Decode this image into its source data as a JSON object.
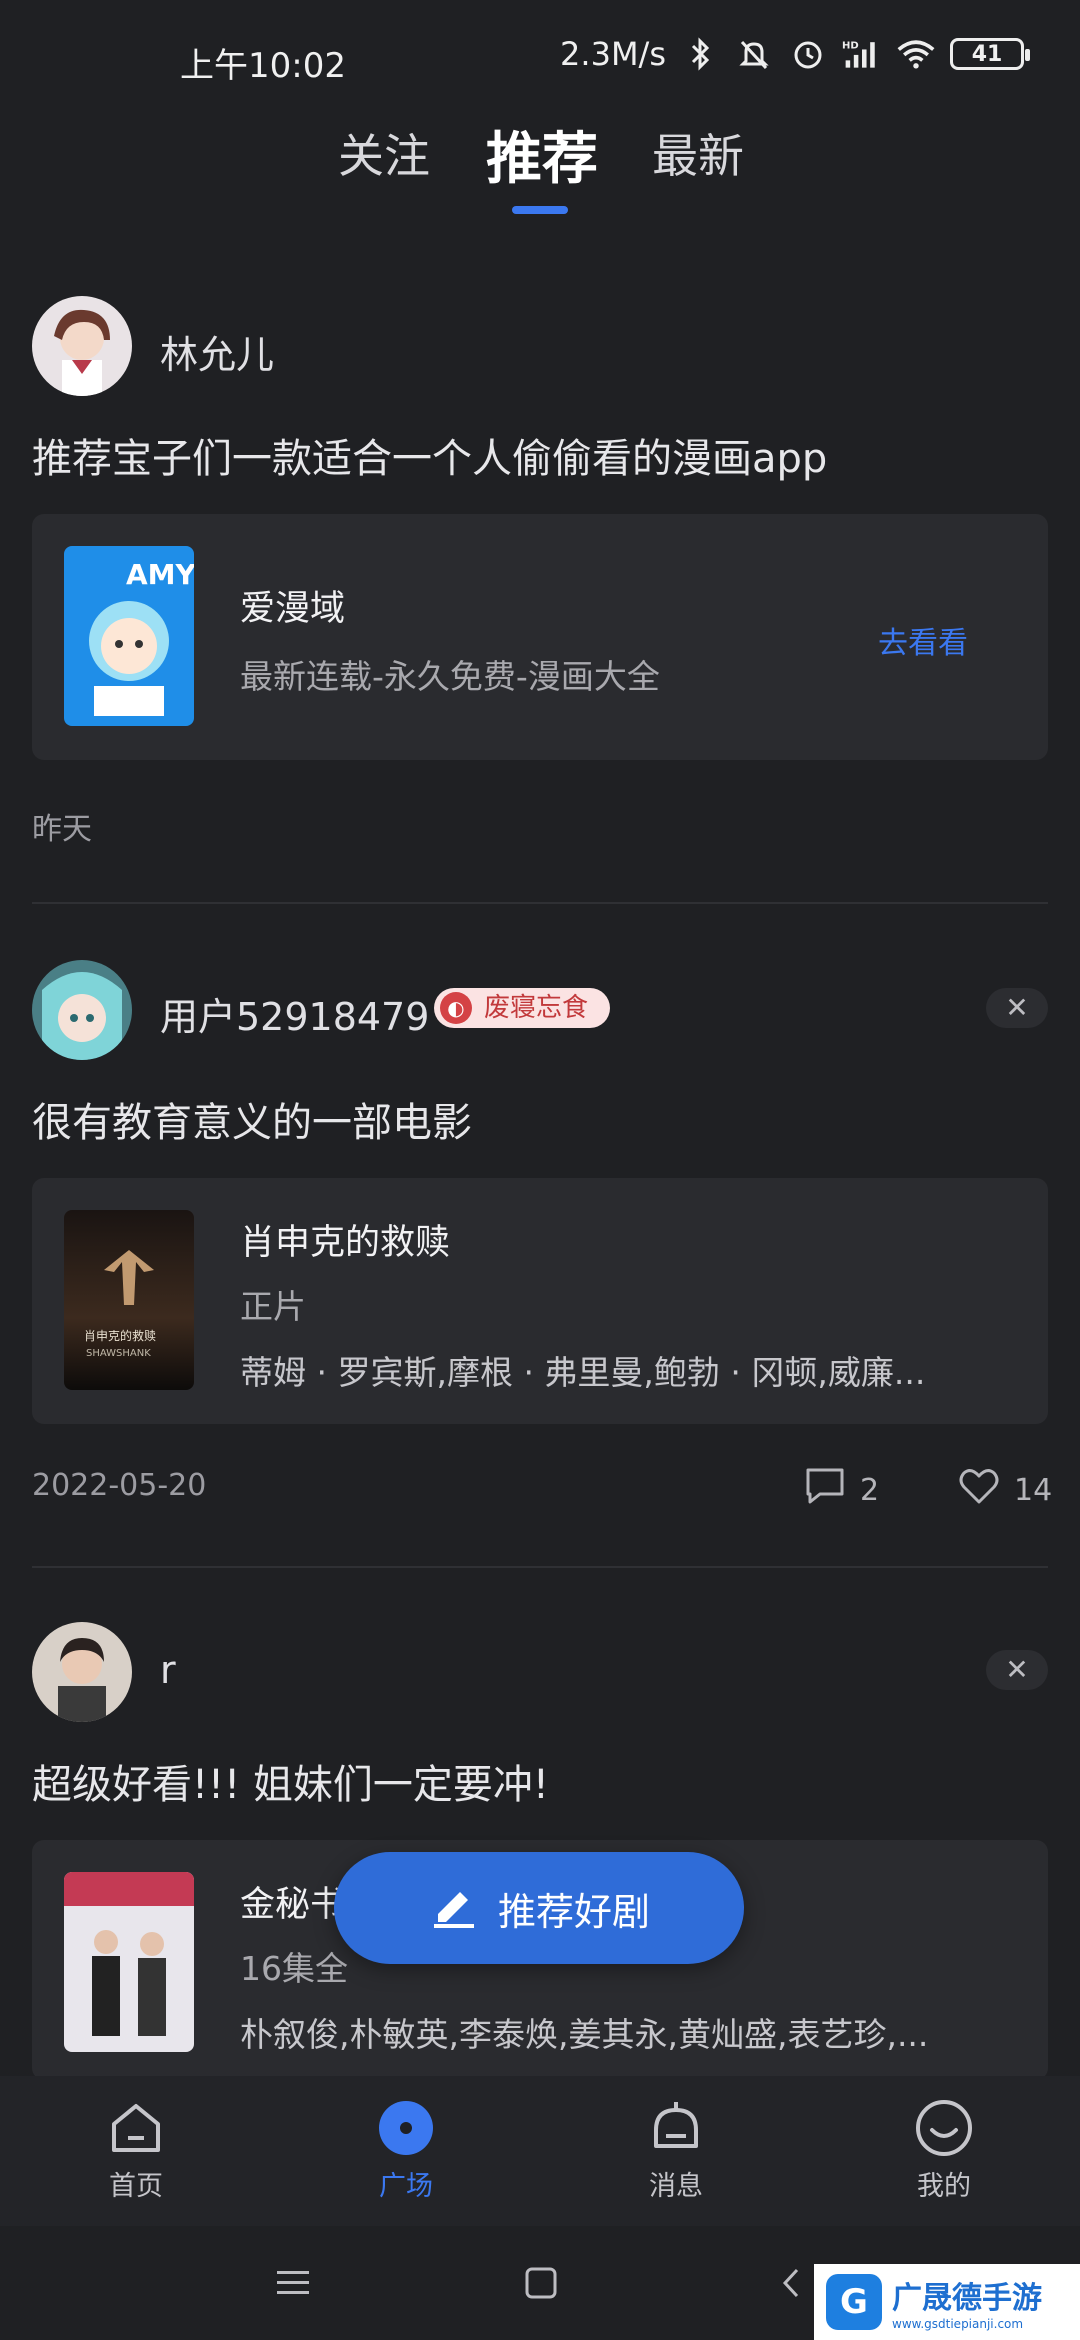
{
  "status_bar": {
    "time": "上午10:02",
    "network_speed": "2.3M/s",
    "battery": "41",
    "icons": [
      "bluetooth-icon",
      "mute-icon",
      "alarm-icon",
      "signal-icon",
      "wifi-icon",
      "battery-icon"
    ],
    "hd_label": "HD"
  },
  "tabs": [
    {
      "label": "关注"
    },
    {
      "label": "推荐",
      "active": true
    },
    {
      "label": "最新"
    }
  ],
  "posts": [
    {
      "username": "林允儿",
      "text": "推荐宝子们一款适合一个人偷偷看的漫画app",
      "card": {
        "title": "爱漫域",
        "subtitle": "最新连载-永久免费-漫画大全",
        "link": "去看看",
        "thumb_text": "AMY"
      },
      "date": "昨天"
    },
    {
      "username": "用户52918479",
      "badge": "废寝忘食",
      "close": "✕",
      "text": "很有教育意义的一部电影",
      "card": {
        "title": "肖申克的救赎",
        "subtitle": "正片",
        "cast": "蒂姆 · 罗宾斯,摩根 · 弗里曼,鲍勃 · 冈顿,威廉...",
        "thumb_text": "肖申克的救赎",
        "thumb_sub": "SHAWSHANK"
      },
      "date": "2022-05-20",
      "comments": "2",
      "likes": "14"
    },
    {
      "username": "r",
      "close": "✕",
      "text": "超级好看!!! 姐妹们一定要冲!",
      "card": {
        "title": "金秘书",
        "subtitle": "16集全",
        "cast": "朴叙俊,朴敏英,李泰焕,姜其永,黄灿盛,表艺珍,..."
      }
    }
  ],
  "fab": {
    "label": "推荐好剧"
  },
  "bottom_nav": [
    {
      "label": "首页",
      "icon": "home-icon"
    },
    {
      "label": "广场",
      "icon": "plaza-icon",
      "active": true
    },
    {
      "label": "消息",
      "icon": "bell-icon"
    },
    {
      "label": "我的",
      "icon": "profile-icon"
    }
  ],
  "watermark": {
    "main": "广晟德手游",
    "sub": "www.gsdtiepianji.com",
    "logo": "G"
  },
  "colors": {
    "accent": "#3b78f0",
    "background": "#1f2023",
    "card": "#2a2b2f",
    "badge_bg": "#fbe3e3",
    "badge_fg": "#c2393b"
  }
}
